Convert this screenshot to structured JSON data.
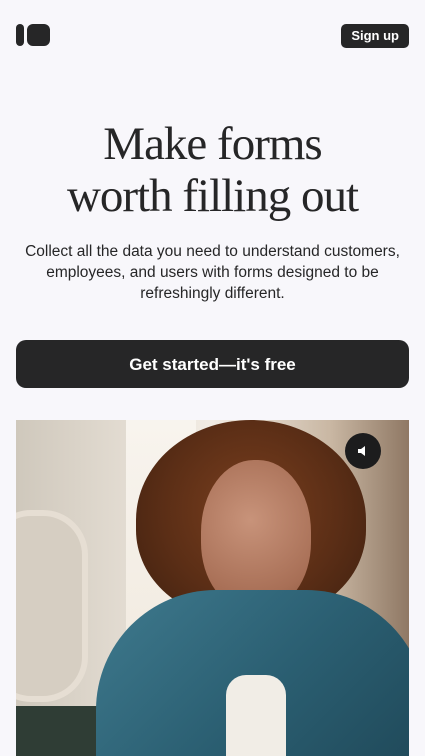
{
  "header": {
    "logo_icon": "typeform-logo-icon",
    "signup_label": "Sign up"
  },
  "hero": {
    "headline_line1": "Make forms",
    "headline_line2": "worth filling out",
    "subhead": "Collect all the data you need to understand customers, employees, and users with forms designed to be refreshingly different.",
    "cta_label": "Get started—it's free"
  },
  "media": {
    "image_subject": "woman with curly hair in denim jacket",
    "mute_icon": "speaker-mute-icon"
  },
  "colors": {
    "background": "#f8f7fb",
    "primary": "#262627",
    "text_on_primary": "#ffffff"
  }
}
